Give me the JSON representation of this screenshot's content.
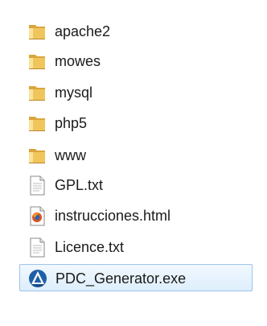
{
  "files": [
    {
      "name": "apache2",
      "icon": "folder-icon"
    },
    {
      "name": "mowes",
      "icon": "folder-icon"
    },
    {
      "name": "mysql",
      "icon": "folder-icon"
    },
    {
      "name": "php5",
      "icon": "folder-icon"
    },
    {
      "name": "www",
      "icon": "folder-icon"
    },
    {
      "name": "GPL.txt",
      "icon": "text-file-icon"
    },
    {
      "name": "instrucciones.html",
      "icon": "html-file-icon"
    },
    {
      "name": "Licence.txt",
      "icon": "text-file-icon"
    },
    {
      "name": "PDC_Generator.exe",
      "icon": "exe-app-icon",
      "selected": true
    }
  ],
  "colors": {
    "folder": "#e8b84a",
    "selection_border": "#9cc3ea",
    "selection_fill": "#ddeefc"
  }
}
